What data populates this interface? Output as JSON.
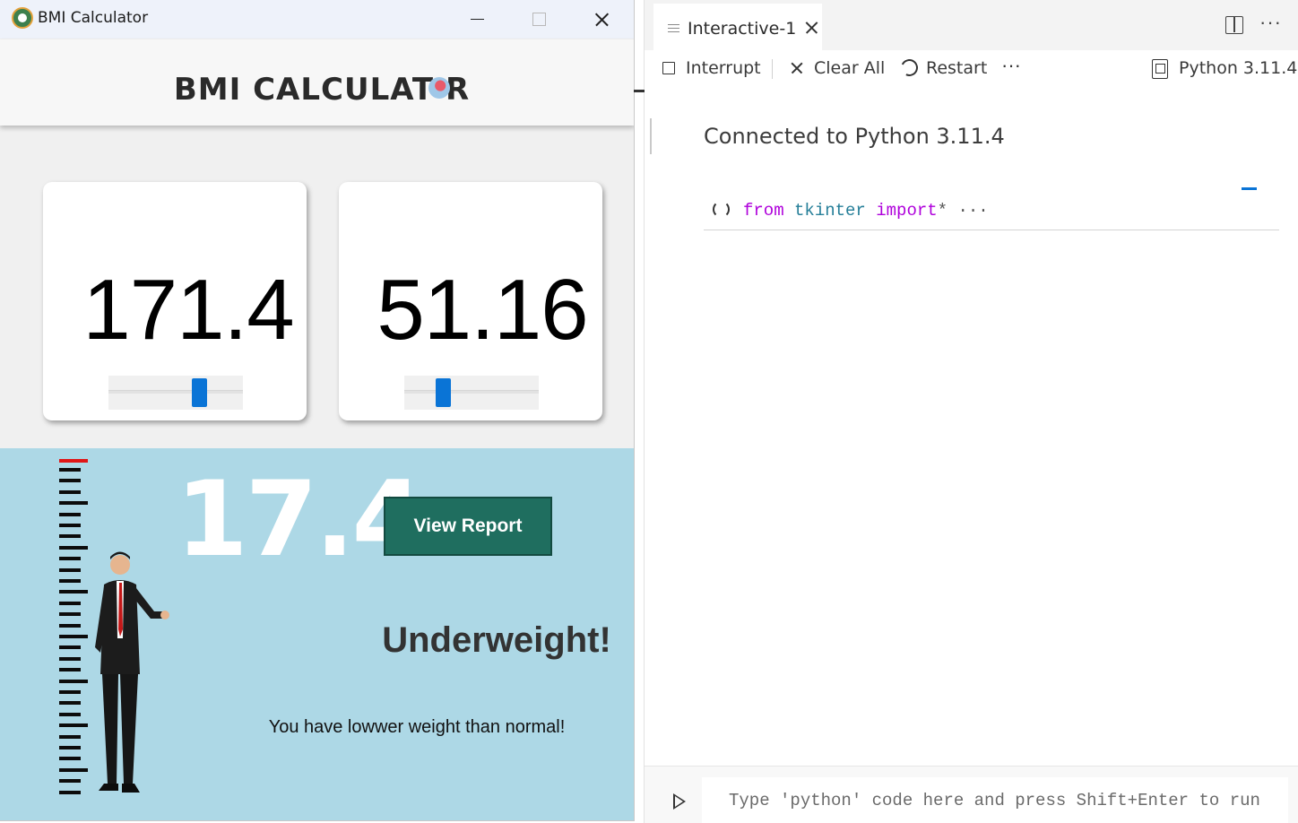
{
  "bmi_window": {
    "title": "BMI Calculator",
    "heading": "BMI CALCULAT R",
    "height_value": "171.4",
    "weight_value": "51.16",
    "height_slider_fraction": 0.7,
    "weight_slider_fraction": 0.26,
    "bmi_value": "17.4",
    "view_report_label": "View Report",
    "status": "Underweight!",
    "description": "You have lowwer weight than normal!"
  },
  "vscode": {
    "tab_label": "Interactive-1",
    "toolbar": {
      "interrupt": "Interrupt",
      "clear_all": "Clear All",
      "restart": "Restart",
      "kernel": "Python 3.11.4"
    },
    "connected_message": "Connected to Python 3.11.4",
    "cell_code": {
      "kw1": "from",
      "module": "tkinter",
      "kw2": "import",
      "rest": "* ···"
    },
    "input_placeholder": "Type 'python' code here and press Shift+Enter to run"
  },
  "icons": {
    "app": "bmi-app-icon",
    "minimize": "minimize-icon",
    "maximize": "maximize-icon",
    "close": "close-icon",
    "tab": "interactive-window-icon",
    "split": "split-editor-icon",
    "interrupt": "stop-icon",
    "clear": "clear-icon",
    "restart": "restart-icon",
    "kernel": "kernel-icon",
    "run": "run-icon"
  },
  "colors": {
    "accent_blue": "#0a74d6",
    "report_button": "#1f6e5f",
    "result_panel": "#add8e6",
    "ruler_marker": "#e01616"
  }
}
